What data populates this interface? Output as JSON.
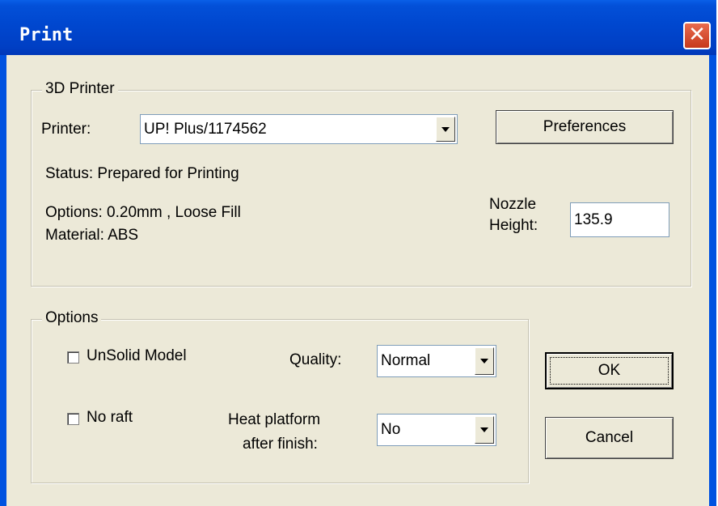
{
  "window": {
    "title": "Print",
    "close_glyph": "✕"
  },
  "printer_group": {
    "legend": "3D Printer",
    "printer_label": "Printer:",
    "printer_value": "UP! Plus/1174562",
    "preferences_label": "Preferences",
    "status": "Status: Prepared for Printing",
    "options": "Options: 0.20mm , Loose Fill",
    "material": "Material: ABS",
    "nozzle_label_1": "Nozzle",
    "nozzle_label_2": "Height:",
    "nozzle_value": "135.9"
  },
  "options_group": {
    "legend": "Options",
    "unsolid_label": "UnSolid Model",
    "unsolid_checked": false,
    "noraft_label": "No raft",
    "noraft_checked": false,
    "quality_label": "Quality:",
    "quality_value": "Normal",
    "heat_label_1": "Heat platform",
    "heat_label_2": "after finish:",
    "heat_value": "No"
  },
  "buttons": {
    "ok": "OK",
    "cancel": "Cancel"
  },
  "colors": {
    "titlebar": "#0047cf",
    "dialog_bg": "#ece9d8",
    "close": "#d5462a"
  }
}
